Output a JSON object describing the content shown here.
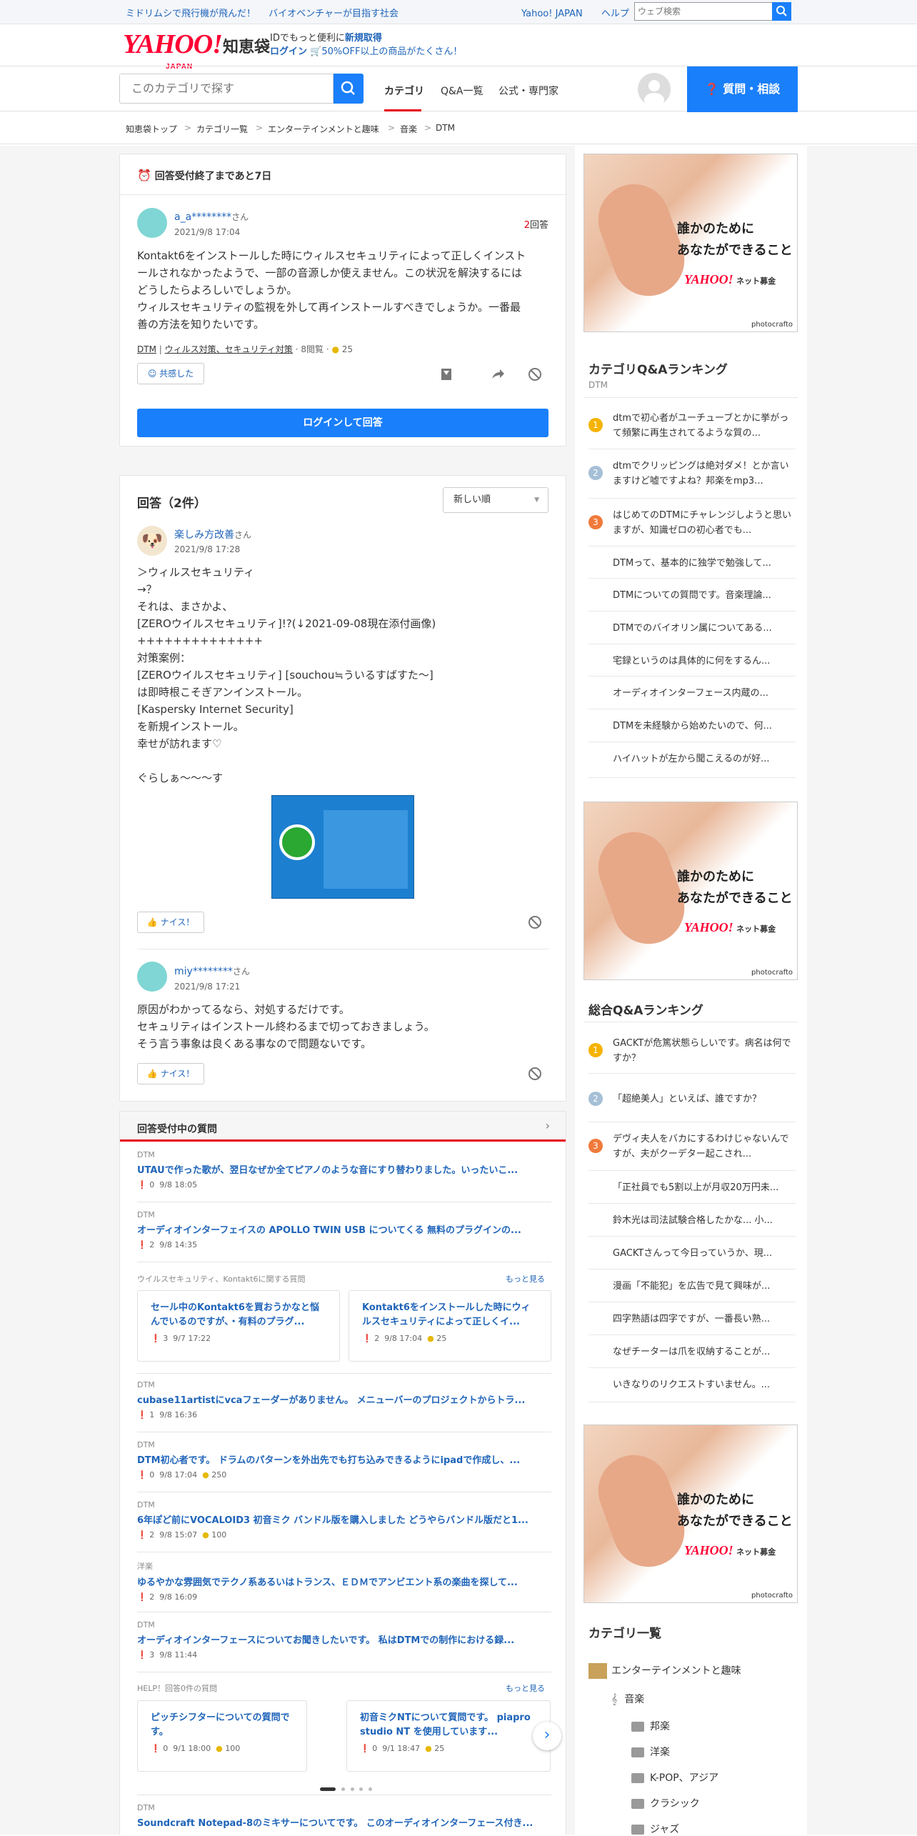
{
  "topbar": {
    "link1": "ミドリムシで飛行機が飛んだ！",
    "link2": "バイオベンチャーが目指す社会",
    "yahoo_japan": "Yahoo! JAPAN",
    "help": "ヘルプ",
    "search_placeholder": "ウェブ検索"
  },
  "brand": {
    "logo": "YAHOO!",
    "logo_sub": "JAPAN",
    "chie": "知恵袋",
    "promo_line1_prefix": "IDでもっと便利に",
    "promo_line1_link": "新規取得",
    "promo_line2_login": "ログイン",
    "promo_line2_text": "50%OFF以上の商品がたくさん！"
  },
  "nav": {
    "search_placeholder": "このカテゴリで探す",
    "tab_category": "カテゴリ",
    "tab_qa": "Q&A一覧",
    "tab_official": "公式・専門家",
    "ask_button": "質問・相談"
  },
  "breadcrumb": [
    "知恵袋トップ",
    "カテゴリ一覧",
    "エンターテインメントと趣味",
    "音楽",
    "DTM"
  ],
  "question": {
    "deadline": "回答受付終了まであと7日",
    "user": "a_a********",
    "san": "さん",
    "date": "2021/9/8 17:04",
    "answer_count": "2",
    "answer_label": "回答",
    "body": [
      "Kontakt6をインストールした時にウィルスセキュリティによって正しくインスト",
      "ールされなかったようで、一部の音源しか使えません。この状況を解決するには",
      "どうしたらよろしいでしょうか。",
      "ウィルスセキュリティの監視を外して再インストールすべきでしょうか。一番最",
      "善の方法を知りたいです。"
    ],
    "tag1": "DTM",
    "tag2": "ウィルス対策、セキュリティ対策",
    "views": "8閲覧",
    "coins": "25",
    "empathy": "共感した",
    "login_answer": "ログインして回答"
  },
  "answers": {
    "heading": "回答（2件）",
    "sort": "新しい順",
    "a1": {
      "user": "楽しみ方改善",
      "san": "さん",
      "date": "2021/9/8 17:28",
      "body": [
        "＞ウィルスセキュリティ",
        "→？",
        "それは、まさかよ、",
        "[ZEROウイルスセキュリティ]!?(↓2021-09-08現在添付画像)",
        "++++++++++++++",
        "対策案例：",
        "[ZEROウイルスセキュリティ] [souchou≒ういるすばすた～]",
        "は即時根こそぎアンインストール。",
        "[Kaspersky Internet Security]",
        "を新規インストール。",
        "幸せが訪れます♡",
        "",
        "ぐらしぁ～～～す"
      ],
      "nice": "ナイス！"
    },
    "a2": {
      "user": "miy********",
      "san": "さん",
      "date": "2021/9/8 17:21",
      "body": [
        "原因がわかってるなら、対処するだけです。",
        "セキュリティはインストール終わるまで切っておきましょう。",
        "そう言う事象は良くある事なので問題ないです。"
      ],
      "nice": "ナイス！"
    }
  },
  "open_questions": {
    "heading": "回答受付中の質問",
    "items": [
      {
        "cat": "DTM",
        "text": "UTAUで作った歌が、翌日なぜか全てピアノのような音にすり替わりました。いったいこ...",
        "answers": "0",
        "date": "9/8 18:05",
        "coins": ""
      },
      {
        "cat": "DTM",
        "text": "オーディオインターフェイスの APOLLO TWIN USB についてくる 無料のプラグインの...",
        "answers": "2",
        "date": "9/8 14:35",
        "coins": ""
      }
    ],
    "related_label": "ウイルスセキュリティ、Kontakt6に関する質問",
    "more": "もっと見る",
    "related": [
      {
        "text": "セール中のKontakt6を買おうかなと悩んでいるのですが、・有料のプラグ...",
        "answers": "3",
        "date": "9/7 17:22",
        "coins": ""
      },
      {
        "text": "Kontakt6をインストールした時にウィルスセキュリティによって正しくイ...",
        "answers": "2",
        "date": "9/8 17:04",
        "coins": "25"
      }
    ],
    "items2": [
      {
        "cat": "DTM",
        "text": "cubase11artistにvcaフェーダーがありません。 メニューバーのプロジェクトからトラ...",
        "answers": "1",
        "date": "9/8 16:36",
        "coins": ""
      },
      {
        "cat": "DTM",
        "text": "DTM初心者です。 ドラムのパターンを外出先でも打ち込みできるようにipadで作成し、...",
        "answers": "0",
        "date": "9/8 17:04",
        "coins": "250"
      },
      {
        "cat": "DTM",
        "text": "6年ぽど前にVOCALOID3 初音ミク バンドル版を購入しました どうやらバンドル版だと1...",
        "answers": "2",
        "date": "9/8 15:07",
        "coins": "100"
      },
      {
        "cat": "洋楽",
        "text": "ゆるやかな雰囲気でテクノ系あるいはトランス、ＥＤＭでアンビエント系の楽曲を探して...",
        "answers": "2",
        "date": "9/8 16:09",
        "coins": ""
      },
      {
        "cat": "DTM",
        "text": "オーディオインターフェースについてお聞きしたいです。 私はDTMでの制作における録...",
        "answers": "3",
        "date": "9/8 11:44",
        "coins": ""
      }
    ],
    "help_label": "HELP！回答0件の質問",
    "help": [
      {
        "text": "ピッチシフターについての質問です。 https://youtu.be/UEYUrZKjEQw?...",
        "answers": "0",
        "date": "9/1 18:00",
        "coins": "100"
      },
      {
        "text": "初音ミクNTについて質問です。 piapro studio NT を使用しています...",
        "answers": "0",
        "date": "9/1 18:47",
        "coins": "25"
      }
    ],
    "last": {
      "cat": "DTM",
      "text": "Soundcraft Notepad-8のミキサーについてです。 このオーディオインターフェース付き..."
    }
  },
  "sidebar": {
    "ad_text_line1": "誰かのために",
    "ad_text_line2": "あなたができること",
    "ad_logo": "YAHOO!",
    "ad_logo_sub": "ネット募金",
    "ad_photo": "photocrafto",
    "cat_rank_title": "カテゴリQ&Aランキング",
    "cat_rank_sub": "DTM",
    "cat_rank": [
      "dtmで初心者がユーチューブとかに挙がって頻繁に再生されてるような質の...",
      "dtmでクリッピングは絶対ダメ！とか言いますけど嘘ですよね？邦楽をmp3...",
      "はじめてのDTMにチャレンジしようと思いますが、知識ゼロの初心者でも...",
      "DTMって、基本的に独学で勉強して...",
      "DTMについての質問です。音楽理論...",
      "DTMでのバイオリン属についてある...",
      "宅録というのは具体的に何をするん...",
      "オーディオインターフェース内蔵の...",
      "DTMを未経験から始めたいので、何...",
      "ハイハットが左から聞こえるのが好..."
    ],
    "all_rank_title": "総合Q&Aランキング",
    "all_rank": [
      "GACKTが危篤状態らしいです。病名は何ですか？",
      "「超絶美人」といえば、誰ですか？",
      "デヴィ夫人をバカにするわけじゃないんですが、夫がクーデター起こされ...",
      "「正社員でも5割以上が月収20万円未...",
      "鈴木光は司法試験合格したかな... 小...",
      "GACKTさんって今日っていうか、現...",
      "漫画「不能犯」を広告で見て興味が...",
      "四字熟語は四字ですが、一番長い熟...",
      "なぜチーターは爪を収納することが...",
      "いきなりのリクエストすいません。..."
    ],
    "catlist_title": "カテゴリ一覧",
    "catlist": [
      "エンターテインメントと趣味",
      "音楽",
      "邦楽",
      "洋楽",
      "K-POP、アジア",
      "クラシック",
      "ジャズ"
    ]
  },
  "colors": {
    "accent": "#1a7ffb",
    "rank1": "#f5b300",
    "rank2": "#a5bfd6",
    "rank3": "#f07a3b",
    "red": "#e60012"
  }
}
